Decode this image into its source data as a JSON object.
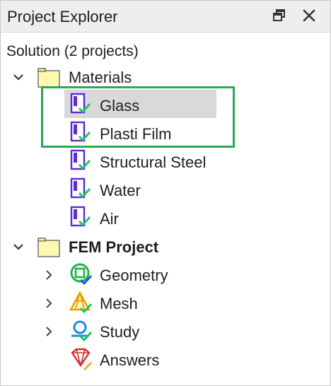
{
  "panel": {
    "title": "Project Explorer",
    "buttons": {
      "float": "float-window-icon",
      "close": "close-icon"
    }
  },
  "tree": {
    "root_label": "Solution (2 projects)",
    "materials": {
      "label": "Materials",
      "items": [
        {
          "label": "Glass",
          "selected": true
        },
        {
          "label": "Plasti Film"
        },
        {
          "label": "Structural Steel"
        },
        {
          "label": "Water"
        },
        {
          "label": "Air"
        }
      ]
    },
    "fem_project": {
      "label": "FEM Project",
      "items": [
        {
          "label": "Geometry"
        },
        {
          "label": "Mesh"
        },
        {
          "label": "Study"
        },
        {
          "label": "Answers"
        }
      ]
    }
  },
  "colors": {
    "highlight_box": "#2aa853",
    "selection": "#d9d9d9",
    "material_icon": "#5a2bd6",
    "check": "#22c55e",
    "folder": "#fff8b0"
  }
}
